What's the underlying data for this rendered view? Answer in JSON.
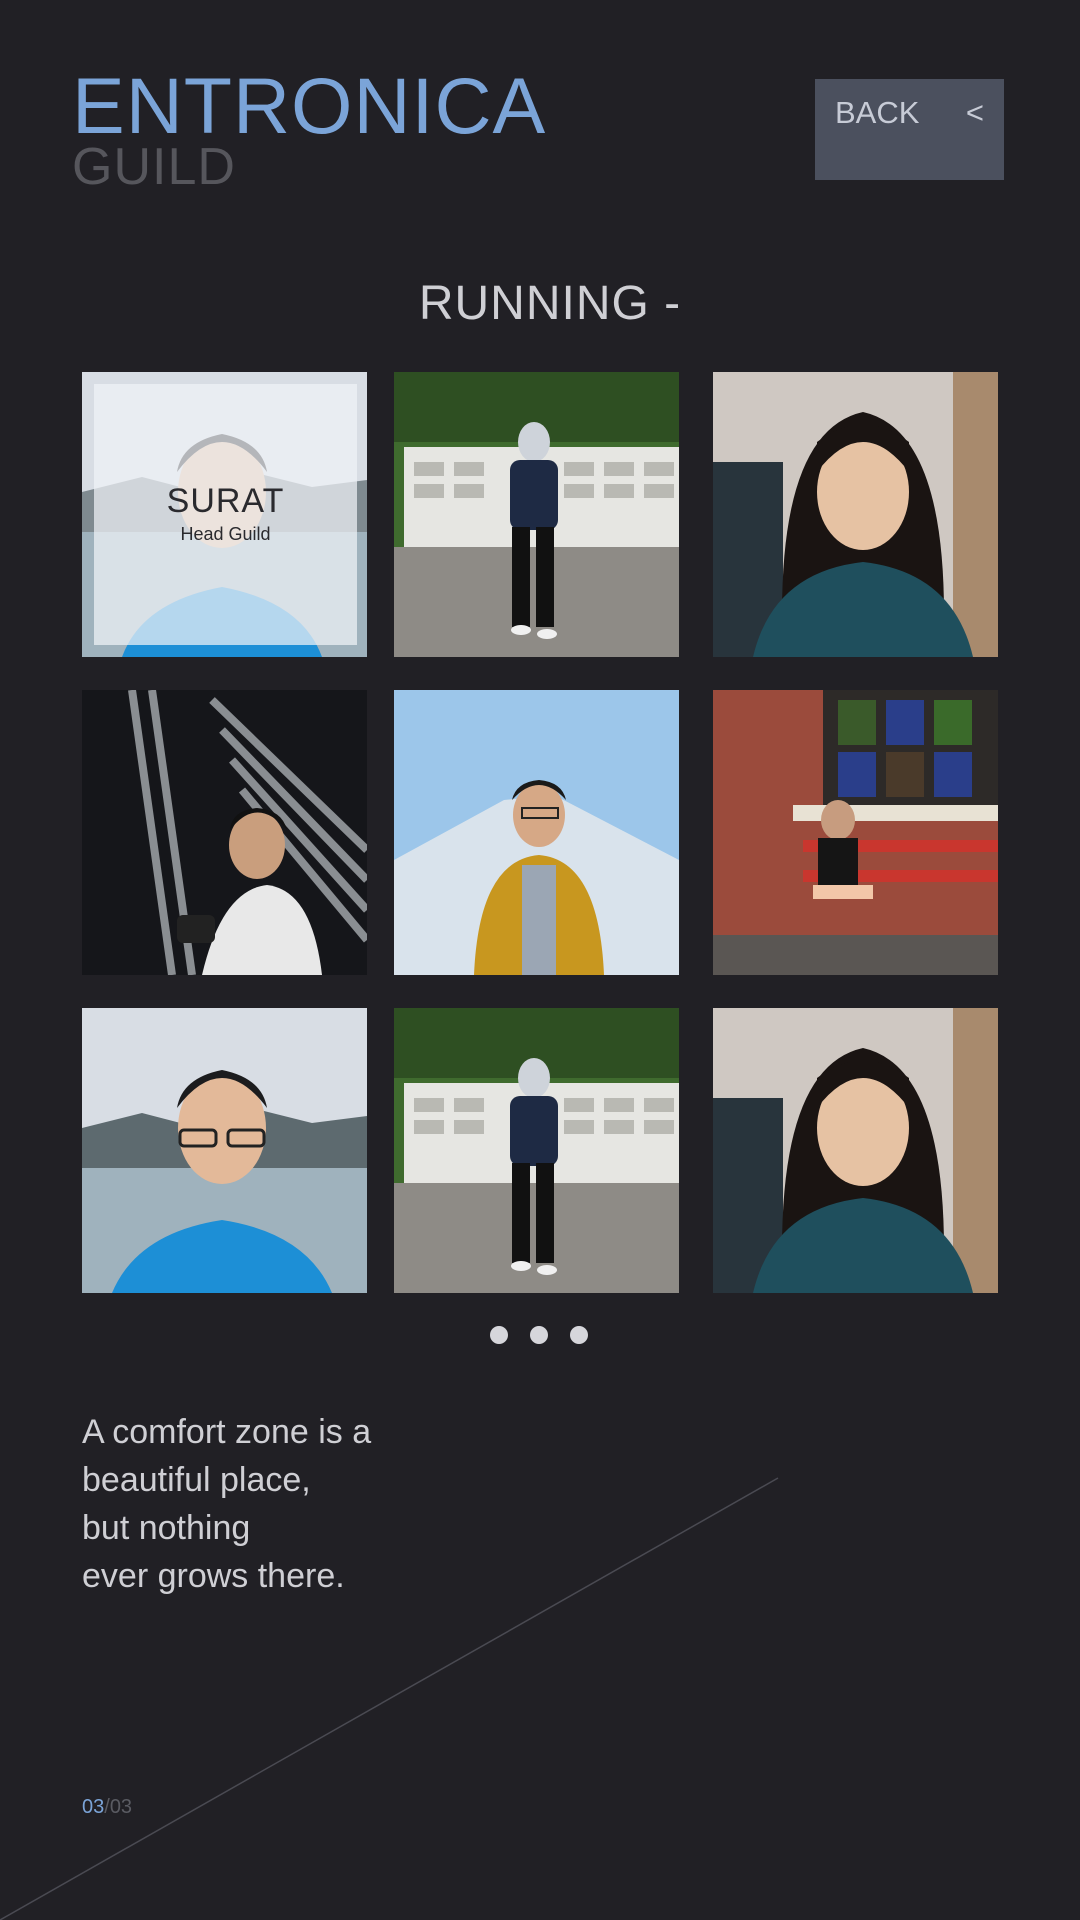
{
  "brand": {
    "title": "ENTRONICA",
    "subtitle": "GUILD"
  },
  "back_button": {
    "label": "BACK",
    "chevron": "<"
  },
  "section": {
    "title": "RUNNING -"
  },
  "gallery": {
    "tiles": [
      {
        "subject": "man-lake-portrait",
        "overlay": {
          "name": "SURAT",
          "role": "Head Guild"
        }
      },
      {
        "subject": "woman-hijab-fence"
      },
      {
        "subject": "woman-long-hair"
      },
      {
        "subject": "man-camera-shutters"
      },
      {
        "subject": "man-yellow-jacket-mountain"
      },
      {
        "subject": "person-red-bench-brick-wall"
      },
      {
        "subject": "man-lake-portrait"
      },
      {
        "subject": "woman-hijab-fence"
      },
      {
        "subject": "woman-long-hair"
      }
    ]
  },
  "pagination": {
    "dots": 3
  },
  "quote": {
    "lines": [
      "A comfort zone is a",
      "beautiful place,",
      "but nothing",
      "ever grows there."
    ]
  },
  "page_counter": {
    "current": "03",
    "separator": "/",
    "total": "03"
  },
  "colors": {
    "background": "#212025",
    "accent": "#7ba4d8",
    "button": "#4b505e",
    "text": "#cfcfd4"
  }
}
